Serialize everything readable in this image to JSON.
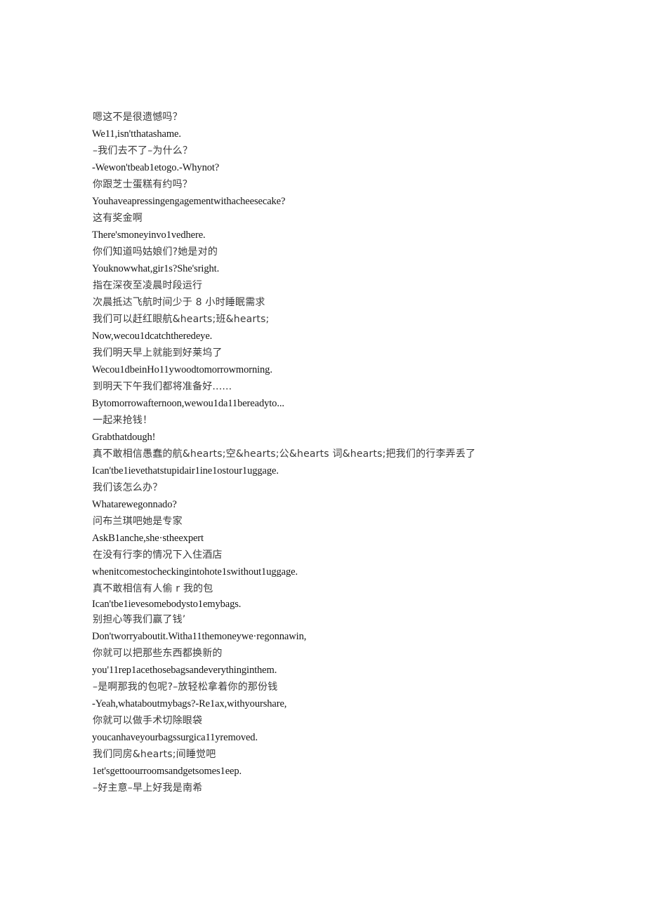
{
  "document": {
    "type": "bilingual-subtitle-transcript",
    "background_color": "#ffffff",
    "text_color": "#1a1a1a",
    "lines": [
      {
        "id": 1,
        "script": "cjk",
        "text": "嗯这不是很遗憾吗？"
      },
      {
        "id": 2,
        "script": "lat",
        "text": "We11,isn'tthatashame."
      },
      {
        "id": 3,
        "script": "cjk",
        "text": "–我们去不了–为什么？"
      },
      {
        "id": 4,
        "script": "lat",
        "text": "-Wewon'tbeab1etogo.-Whynot?"
      },
      {
        "id": 5,
        "script": "cjk",
        "text": "你跟芝士蛋糕有约吗？"
      },
      {
        "id": 6,
        "script": "lat",
        "text": "Youhaveapressingengagementwithacheesecake?"
      },
      {
        "id": 7,
        "script": "cjk",
        "text": "这有奖金啊"
      },
      {
        "id": 8,
        "script": "lat",
        "text": "There'smoneyinvo1vedhere."
      },
      {
        "id": 9,
        "script": "cjk",
        "text": "你们知道吗姑娘们?她是对的"
      },
      {
        "id": 10,
        "script": "lat",
        "text": "Youknowwhat,gir1s?She'sright."
      },
      {
        "id": 11,
        "script": "cjk",
        "text": "指在深夜至凌晨时段运行"
      },
      {
        "id": 12,
        "script": "cjk",
        "text": "次晨抵达飞航时间少于 8 小时睡眠需求"
      },
      {
        "id": 13,
        "script": "cjk",
        "text": "我们可以赶红眼航&hearts;班&hearts;"
      },
      {
        "id": 14,
        "script": "lat",
        "text": "Now,wecou1dcatchtheredeye."
      },
      {
        "id": 15,
        "script": "cjk",
        "text": "我们明天早上就能到好莱坞了"
      },
      {
        "id": 16,
        "script": "lat",
        "text": "Wecou1dbeinHo11ywoodtomorrowmorning."
      },
      {
        "id": 17,
        "script": "cjk",
        "text": "到明天下午我们都将准备好......"
      },
      {
        "id": 18,
        "script": "lat",
        "text": "Bytomorrowafternoon,wewou1da11bereadyto..."
      },
      {
        "id": 19,
        "script": "cjk",
        "text": "一起来抢钱！"
      },
      {
        "id": 20,
        "script": "lat",
        "text": "Grabthatdough!"
      },
      {
        "id": 21,
        "script": "cjk",
        "text": "真不敢相信愚蠢的航&hearts;空&hearts;公&hearts 词&hearts;把我们的行李弄丢了"
      },
      {
        "id": 22,
        "script": "lat",
        "text": "Ican'tbe1ievethatstupidair1ine1ostour1uggage."
      },
      {
        "id": 23,
        "script": "cjk",
        "text": "我们该怎么办？"
      },
      {
        "id": 24,
        "script": "lat",
        "text": "Whatarewegonnado?"
      },
      {
        "id": 25,
        "script": "cjk",
        "text": "问布兰琪吧她是专家"
      },
      {
        "id": 26,
        "script": "lat",
        "text": "AskB1anche,she·stheexpert"
      },
      {
        "id": 27,
        "script": "cjk",
        "text": "在没有行李的情况下入住酒店"
      },
      {
        "id": 28,
        "script": "lat",
        "text": "whenitcomestocheckingintohote1swithout1uggage."
      },
      {
        "id": 29,
        "script": "cjk",
        "text": "真不敢相信有人偷 r 我的包"
      },
      {
        "id": 30,
        "script": "lat",
        "text": "Ican'tbe1ievesomebodysto1emybags.",
        "tight": true
      },
      {
        "id": 31,
        "script": "cjk",
        "text": "别担心等我们赢了钱’"
      },
      {
        "id": 32,
        "script": "lat",
        "text": "Don'tworryaboutit.Witha11themoneywe·regonnawin,"
      },
      {
        "id": 33,
        "script": "cjk",
        "text": "你就可以把那些东西都换新的"
      },
      {
        "id": 34,
        "script": "lat",
        "text": "you'11rep1acethosebagsandeverythinginthem."
      },
      {
        "id": 35,
        "script": "cjk",
        "text": "–是啊那我的包呢?–放轻松拿着你的那份钱"
      },
      {
        "id": 36,
        "script": "lat",
        "text": "-Yeah,whataboutmybags?-Re1ax,withyourshare,"
      },
      {
        "id": 37,
        "script": "cjk",
        "text": "你就可以做手术切除眼袋"
      },
      {
        "id": 38,
        "script": "lat",
        "text": "youcanhaveyourbagssurgica11yremoved."
      },
      {
        "id": 39,
        "script": "cjk",
        "text": "我们同房&hearts;间睡觉吧"
      },
      {
        "id": 40,
        "script": "lat",
        "text": "1et'sgettoourroomsandgetsomes1eep."
      },
      {
        "id": 41,
        "script": "cjk",
        "text": "–好主意–早上好我是南希"
      }
    ]
  }
}
